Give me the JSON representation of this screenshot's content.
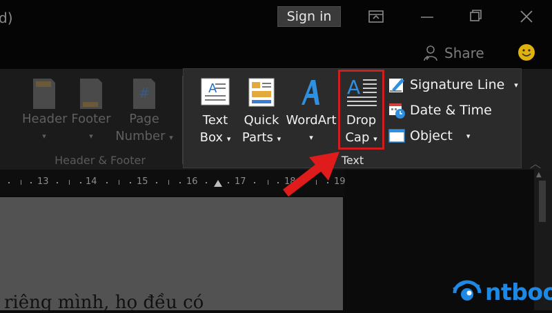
{
  "titlebar": {
    "title_fragment": "d)",
    "signin_label": "Sign in"
  },
  "sharebar": {
    "share_label": "Share"
  },
  "ribbon": {
    "header_footer_group": {
      "label": "Header & Footer",
      "buttons": [
        {
          "line1": "Header",
          "line2": ""
        },
        {
          "line1": "Footer",
          "line2": ""
        },
        {
          "line1": "Page",
          "line2": "Number"
        }
      ]
    },
    "text_group": {
      "label": "Text",
      "buttons": [
        {
          "line1": "Text",
          "line2": "Box"
        },
        {
          "line1": "Quick",
          "line2": "Parts"
        },
        {
          "line1": "WordArt",
          "line2": ""
        },
        {
          "line1": "Drop",
          "line2": "Cap"
        }
      ],
      "small_buttons": [
        {
          "label": "Signature Line"
        },
        {
          "label": "Date & Time"
        },
        {
          "label": "Object"
        }
      ]
    }
  },
  "ruler": {
    "labels": [
      "13",
      "14",
      "15",
      "16",
      "17",
      "18",
      "19"
    ]
  },
  "document": {
    "visible_text": "riêng mình, họ đều có"
  },
  "logo": {
    "text": "ntbook"
  },
  "colors": {
    "highlight": "#cc1f1f",
    "arrow": "#e01b1b",
    "accent": "#1e88e5"
  }
}
